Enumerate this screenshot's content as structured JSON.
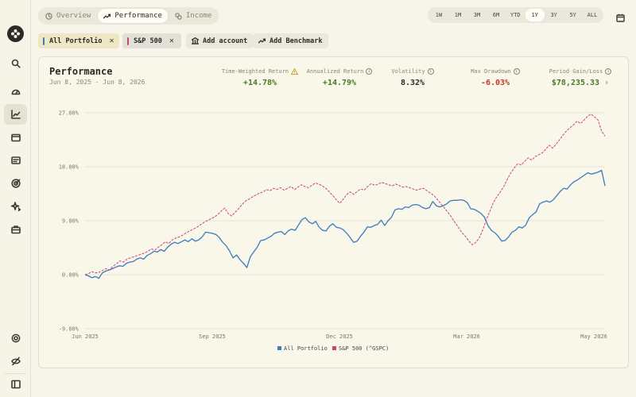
{
  "tabs": [
    {
      "label": "Overview",
      "icon": "clock-icon",
      "active": false
    },
    {
      "label": "Performance",
      "icon": "trend-up-icon",
      "active": true
    },
    {
      "label": "Income",
      "icon": "coins-icon",
      "active": false
    }
  ],
  "periods": [
    "1W",
    "1M",
    "3M",
    "6M",
    "YTD",
    "1Y",
    "3Y",
    "5Y",
    "ALL"
  ],
  "active_period": "1Y",
  "filters": {
    "portfolio_chip": {
      "label": "All Portfolio",
      "color": "#3b7bbf"
    },
    "benchmark_chip": {
      "label": "S&P 500",
      "color": "#c5467a"
    },
    "add_account": "Add account",
    "add_benchmark": "Add Benchmark"
  },
  "card": {
    "title": "Performance",
    "date_range": "Jun 8, 2025 - Jun 8, 2026"
  },
  "metrics": {
    "twr": {
      "label": "Time-Weighted Return",
      "value": "+14.78%"
    },
    "annualized": {
      "label": "Annualized Return",
      "value": "+14.79%"
    },
    "volatility": {
      "label": "Volatility",
      "value": "8.32%"
    },
    "drawdown": {
      "label": "Max Drawdown",
      "value": "-6.03%"
    },
    "gain": {
      "label": "Period Gain/Loss",
      "value": "$78,235.33"
    }
  },
  "chart_data": {
    "type": "line",
    "ylim": [
      -9,
      27
    ],
    "y_ticks": [
      "27.00%",
      "18.00%",
      "9.00%",
      "0.00%",
      "-9.00%"
    ],
    "x_ticks": [
      "Jun 2025",
      "Sep 2025",
      "Dec 2025",
      "Mar 2026",
      "May 2026"
    ],
    "series": [
      {
        "name": "All Portfolio",
        "color": "#3b7bbf",
        "style": "solid",
        "values": [
          0,
          -0.2,
          -0.5,
          -0.3,
          -0.6,
          0.3,
          0.6,
          0.8,
          1.0,
          1.3,
          1.5,
          1.4,
          1.9,
          2.1,
          2.2,
          2.6,
          2.8,
          2.6,
          3.2,
          3.5,
          3.9,
          3.8,
          4.2,
          3.9,
          4.6,
          5.1,
          5.4,
          5.2,
          5.5,
          5.8,
          5.5,
          6.0,
          5.6,
          5.8,
          6.3,
          7.1,
          7.0,
          6.9,
          6.7,
          6.2,
          5.4,
          4.8,
          3.9,
          2.8,
          3.3,
          2.5,
          1.9,
          1.2,
          3.0,
          3.8,
          4.6,
          5.7,
          5.8,
          6.1,
          6.4,
          6.9,
          7.1,
          7.2,
          6.7,
          7.3,
          7.6,
          7.4,
          8.3,
          9.2,
          9.5,
          8.8,
          8.5,
          8.9,
          7.9,
          7.4,
          7.3,
          8.1,
          8.5,
          7.9,
          7.8,
          7.5,
          6.9,
          6.2,
          5.4,
          5.6,
          6.4,
          7.1,
          8.0,
          7.9,
          8.2,
          8.4,
          9.1,
          8.2,
          9.0,
          9.6,
          10.8,
          11.0,
          10.9,
          11.3,
          11.2,
          11.6,
          11.7,
          11.6,
          11.2,
          11.0,
          11.2,
          12.2,
          11.5,
          11.3,
          11.5,
          11.8,
          12.3,
          12.4,
          12.4,
          12.5,
          12.4,
          12.0,
          11.0,
          10.9,
          10.6,
          10.2,
          9.6,
          8.2,
          7.4,
          7.0,
          6.4,
          5.6,
          5.7,
          6.3,
          7.1,
          7.4,
          8.0,
          7.8,
          8.3,
          9.5,
          10.0,
          10.5,
          11.8,
          12.1,
          12.3,
          12.1,
          12.5,
          13.2,
          13.9,
          14.4,
          14.3,
          15.0,
          15.5,
          15.8,
          16.2,
          16.6,
          17.0,
          16.8,
          16.9,
          17.1,
          17.4,
          14.8
        ]
      },
      {
        "name": "S&P 500 (^GSPC)",
        "color": "#c5467a",
        "style": "dashed",
        "values": [
          0,
          0.2,
          0.5,
          0.3,
          0.4,
          0.7,
          1.0,
          0.8,
          1.4,
          1.8,
          2.3,
          2.1,
          2.6,
          2.8,
          3.0,
          3.2,
          3.4,
          3.6,
          3.9,
          4.3,
          4.1,
          4.6,
          5.0,
          5.5,
          5.2,
          5.8,
          6.1,
          6.3,
          6.6,
          7.0,
          7.3,
          7.6,
          7.9,
          8.3,
          8.7,
          9.0,
          9.3,
          9.6,
          10.0,
          10.6,
          11.1,
          10.2,
          9.8,
          10.4,
          11.0,
          11.7,
          12.3,
          12.6,
          13.0,
          13.3,
          13.6,
          13.8,
          14.2,
          14.0,
          14.4,
          14.2,
          14.5,
          14.1,
          14.4,
          14.7,
          14.2,
          14.6,
          15.0,
          14.7,
          14.5,
          14.9,
          15.3,
          15.1,
          14.8,
          14.4,
          13.8,
          13.2,
          12.5,
          11.9,
          12.6,
          13.4,
          13.8,
          13.4,
          13.9,
          14.3,
          14.1,
          14.7,
          15.2,
          14.9,
          15.1,
          15.4,
          15.2,
          15.0,
          14.8,
          15.1,
          14.9,
          14.6,
          14.7,
          14.5,
          14.3,
          14.1,
          14.3,
          14.4,
          14.0,
          13.6,
          13.2,
          12.5,
          11.8,
          11.1,
          10.4,
          9.6,
          8.7,
          7.9,
          7.0,
          6.4,
          5.6,
          5.0,
          5.4,
          6.2,
          7.5,
          9.2,
          10.6,
          12.0,
          13.0,
          13.8,
          14.7,
          15.9,
          17.0,
          17.8,
          18.5,
          18.3,
          18.9,
          19.5,
          19.1,
          19.7,
          20.0,
          20.3,
          20.9,
          21.6,
          21.1,
          21.8,
          22.5,
          23.3,
          24.0,
          24.5,
          25.0,
          25.6,
          25.2,
          25.8,
          26.4,
          26.8,
          26.3,
          25.8,
          24.0,
          23.1
        ]
      }
    ]
  },
  "legend": [
    "All Portfolio",
    "S&P 500 (^GSPC)"
  ]
}
